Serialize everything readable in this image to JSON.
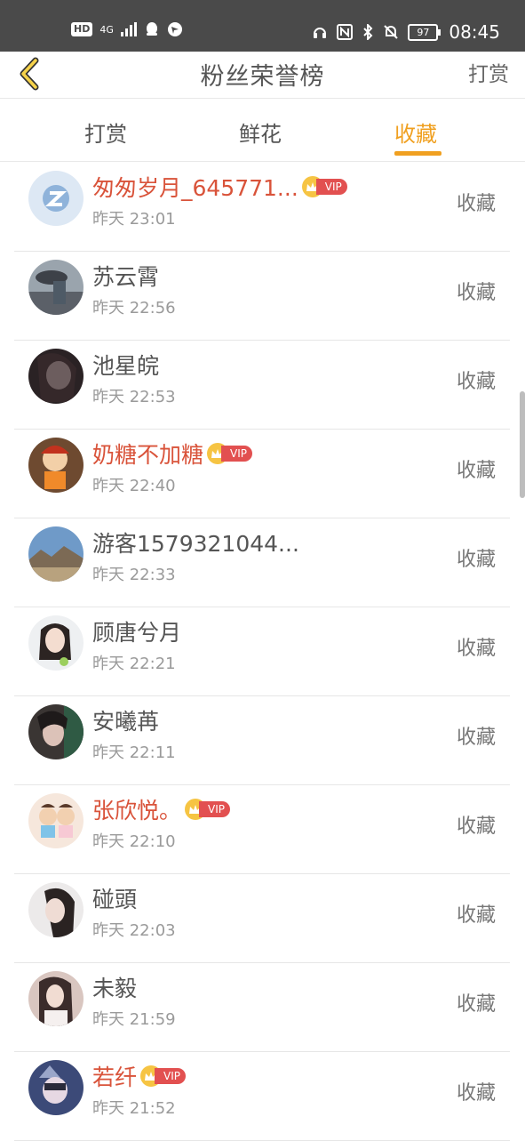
{
  "status_bar": {
    "hd": "HD",
    "network": "4G",
    "battery": "97",
    "time": "08:45"
  },
  "nav": {
    "title": "粉丝荣誉榜",
    "right": "打赏"
  },
  "tabs": [
    {
      "label": "打赏",
      "active": false
    },
    {
      "label": "鲜花",
      "active": false
    },
    {
      "label": "收藏",
      "active": true
    }
  ],
  "colors": {
    "accent": "#f0a020",
    "vip_name": "#d9533a",
    "vip_tag": "#e25050",
    "status_bar": "#4a4a4a"
  },
  "vip_label": "VIP",
  "rows": [
    {
      "name": "匆匆岁月_645771...",
      "time": "昨天 23:01",
      "action": "收藏",
      "vip": true
    },
    {
      "name": "苏云霄",
      "time": "昨天 22:56",
      "action": "收藏",
      "vip": false
    },
    {
      "name": "池星皖",
      "time": "昨天 22:53",
      "action": "收藏",
      "vip": false
    },
    {
      "name": "奶糖不加糖",
      "time": "昨天 22:40",
      "action": "收藏",
      "vip": true
    },
    {
      "name": "游客1579321044...",
      "time": "昨天 22:33",
      "action": "收藏",
      "vip": false
    },
    {
      "name": "顾唐兮月",
      "time": "昨天 22:21",
      "action": "收藏",
      "vip": false
    },
    {
      "name": "安曦苒",
      "time": "昨天 22:11",
      "action": "收藏",
      "vip": false
    },
    {
      "name": "张欣悦。",
      "time": "昨天 22:10",
      "action": "收藏",
      "vip": true
    },
    {
      "name": "碰頭",
      "time": "昨天 22:03",
      "action": "收藏",
      "vip": false
    },
    {
      "name": "未毅",
      "time": "昨天 21:59",
      "action": "收藏",
      "vip": false
    },
    {
      "name": "若纤",
      "time": "昨天 21:52",
      "action": "收藏",
      "vip": true
    }
  ]
}
